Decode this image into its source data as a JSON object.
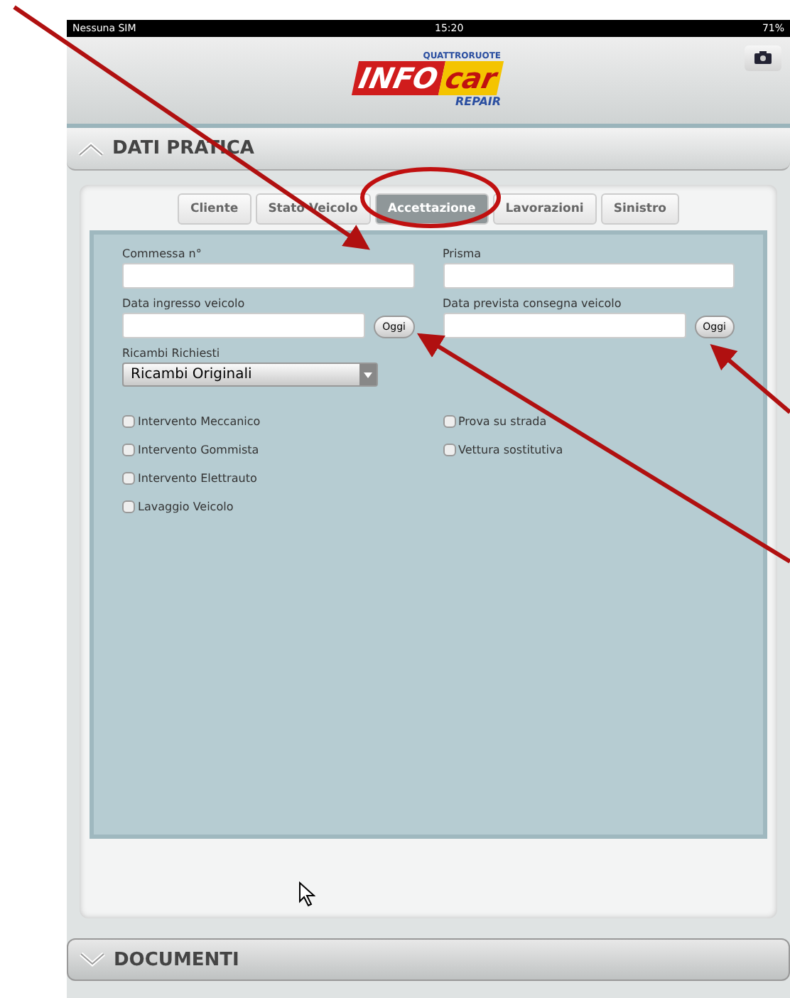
{
  "status_bar": {
    "carrier": "Nessuna SIM",
    "time": "15:20",
    "battery": "71%"
  },
  "logo": {
    "brand_top": "QUATTRORUOTE",
    "brand_left": "INFO",
    "brand_right": "car",
    "brand_bottom": "REPAIR"
  },
  "section": {
    "title": "DATI PRATICA",
    "expanded": true
  },
  "tabs": [
    {
      "label": "Cliente",
      "selected": false
    },
    {
      "label": "Stato Veicolo",
      "selected": false
    },
    {
      "label": "Accettazione",
      "selected": true
    },
    {
      "label": "Lavorazioni",
      "selected": false
    },
    {
      "label": "Sinistro",
      "selected": false
    }
  ],
  "fields": [
    {
      "label": "Commessa n°"
    },
    {
      "label": "Prisma"
    }
  ],
  "date_fields": [
    {
      "label": "Data ingresso veicolo",
      "button": "Oggi"
    },
    {
      "label": "Data prevista consegna veicolo",
      "button": "Oggi"
    }
  ],
  "dropdown": {
    "label": "Ricambi Richiesti",
    "value": "Ricambi Originali"
  },
  "checkboxes_left": [
    {
      "label": "Intervento Meccanico",
      "checked": false
    },
    {
      "label": "Intervento Gommista",
      "checked": false
    },
    {
      "label": "Intervento Elettrauto",
      "checked": false
    },
    {
      "label": "Lavaggio Veicolo",
      "checked": false
    }
  ],
  "checkboxes_right": [
    {
      "label": "Prova su strada",
      "checked": false
    },
    {
      "label": "Vettura sostitutiva",
      "checked": false
    }
  ],
  "collapsed_section": {
    "title": "DOCUMENTI",
    "expanded": false
  }
}
